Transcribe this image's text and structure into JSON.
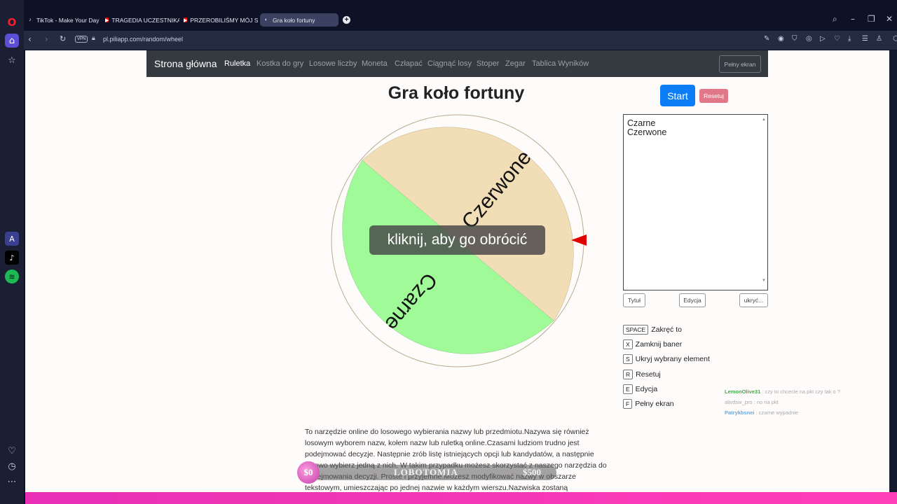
{
  "browser": {
    "tabs": [
      {
        "label": "TikTok - Make Your Day",
        "icon": "tiktok-icon"
      },
      {
        "label": "TRAGEDIA UCZESTNIKA P",
        "icon": "youtube-icon"
      },
      {
        "label": "PRZEROBILIŚMY MÓJ SAM",
        "icon": "youtube-icon"
      },
      {
        "label": "Gra koło fortuny",
        "icon": "piliapp-icon"
      }
    ],
    "new_tab": "+",
    "vpn_label": "VPN",
    "url": "pl.piliapp.com/random/wheel"
  },
  "site": {
    "brand": "Strona główna",
    "nav": [
      "Ruletka",
      "Kostka do gry",
      "Losowe liczby",
      "Moneta",
      "Człapać",
      "Ciągnąć losy",
      "Stoper",
      "Zegar",
      "Tablica Wyników"
    ],
    "fullscreen_button": "Pełny ekran"
  },
  "main": {
    "title": "Gra koło fortuny",
    "start": "Start",
    "reset": "Resetuj",
    "overlay": "kliknij, aby go obrócić",
    "wheel": {
      "segments": [
        {
          "label": "Czerwone",
          "color": "#f2deb6"
        },
        {
          "label": "Czarne",
          "color": "#a0fa98"
        }
      ],
      "pointer_color": "#e00000"
    },
    "names_line1": "Czarne",
    "names_line2": "Czerwone",
    "buttons": {
      "title": "Tytuł",
      "edit": "Edycja",
      "hide": "ukryć..."
    },
    "shortcuts": [
      {
        "key": "SPACE",
        "action": "Zakręć to"
      },
      {
        "key": "X",
        "action": "Zamknij baner"
      },
      {
        "key": "S",
        "action": "Ukryj wybrany element"
      },
      {
        "key": "R",
        "action": "Resetuj"
      },
      {
        "key": "E",
        "action": "Edycja"
      },
      {
        "key": "F",
        "action": "Pełny ekran"
      }
    ],
    "description": "To narzędzie online do losowego wybierania nazwy lub przedmiotu.Nazywa się również losowym wyborem nazw, kołem nazw lub ruletką online.Czasami ludziom trudno jest podejmować decyzje. Następnie zrób listę istniejących opcji lub kandydatów, a następnie losowo wybierz jedną z nich. W takim przypadku możesz skorzystać z naszego narzędzia do podejmowania decyzji. Proste i przyjemne.Możesz modyfikować nazwy w obszarze tekstowym, umieszczając po jednej nazwie w każdym wierszu.Nazwiska zostaną narysowane"
  },
  "overlay_stream": {
    "coin": "$0",
    "label": "LOBOTOMIA",
    "amount": "$500"
  },
  "chat": [
    {
      "user": "LemonOlive31",
      "text": ": czy to chcecie na pkt czy tak o ?"
    },
    {
      "user": "alivdsw_pro",
      "text": ": no na pkt"
    },
    {
      "user": "Patrykbsnei",
      "text": ": czarne wypadnie"
    }
  ]
}
